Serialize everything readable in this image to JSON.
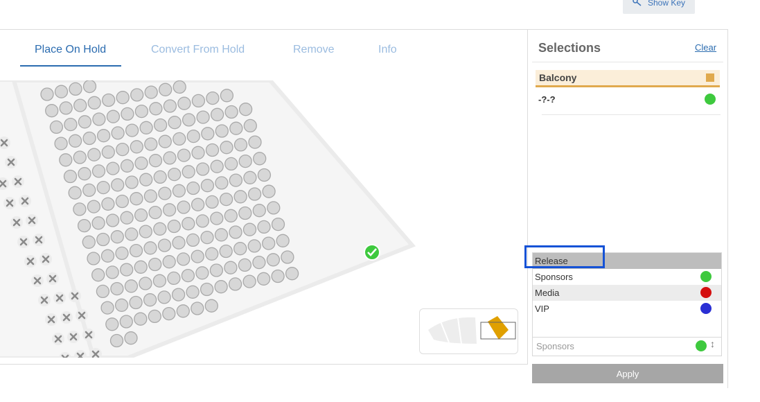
{
  "header": {
    "show_key_label": "Show Key",
    "show_key_icon": "key-icon"
  },
  "tabs": [
    {
      "label": "Place On Hold",
      "active": true
    },
    {
      "label": "Convert From Hold",
      "active": false
    },
    {
      "label": "Remove",
      "active": false
    },
    {
      "label": "Info",
      "active": false
    }
  ],
  "selections": {
    "title": "Selections",
    "clear_label": "Clear",
    "section": {
      "label": "Balcony",
      "color": "#e0a94d"
    },
    "seat": {
      "label": "-?-?",
      "status_color": "#3ec93e"
    }
  },
  "hold_types": [
    {
      "label": "Release",
      "color": null
    },
    {
      "label": "Sponsors",
      "color": "#3ec93e"
    },
    {
      "label": "Media",
      "color": "#d40f0f"
    },
    {
      "label": "VIP",
      "color": "#2a2fd4"
    }
  ],
  "hold_select": {
    "placeholder": "Sponsors",
    "color": "#3ec93e"
  },
  "apply_label": "Apply",
  "colors": {
    "accent": "#2b6cb0",
    "seat_available": "#d7d7d7",
    "seat_selected": "#3ec93e"
  }
}
